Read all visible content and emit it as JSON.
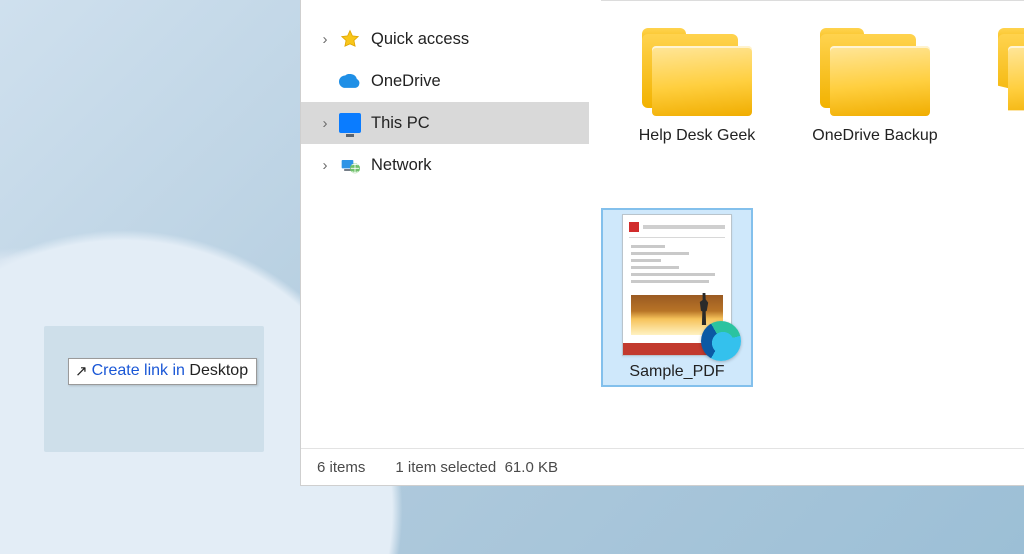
{
  "nav": {
    "quick_access": "Quick access",
    "onedrive": "OneDrive",
    "this_pc": "This PC",
    "network": "Network"
  },
  "tiles": {
    "folder1": "Help Desk Geek",
    "folder2": "OneDrive Backup",
    "pdf": "Sample_PDF"
  },
  "status": {
    "items": "6 items",
    "selected": "1 item selected",
    "size": "61.0 KB"
  },
  "drag_tip": {
    "prefix": "Create link in ",
    "target": "Desktop"
  }
}
